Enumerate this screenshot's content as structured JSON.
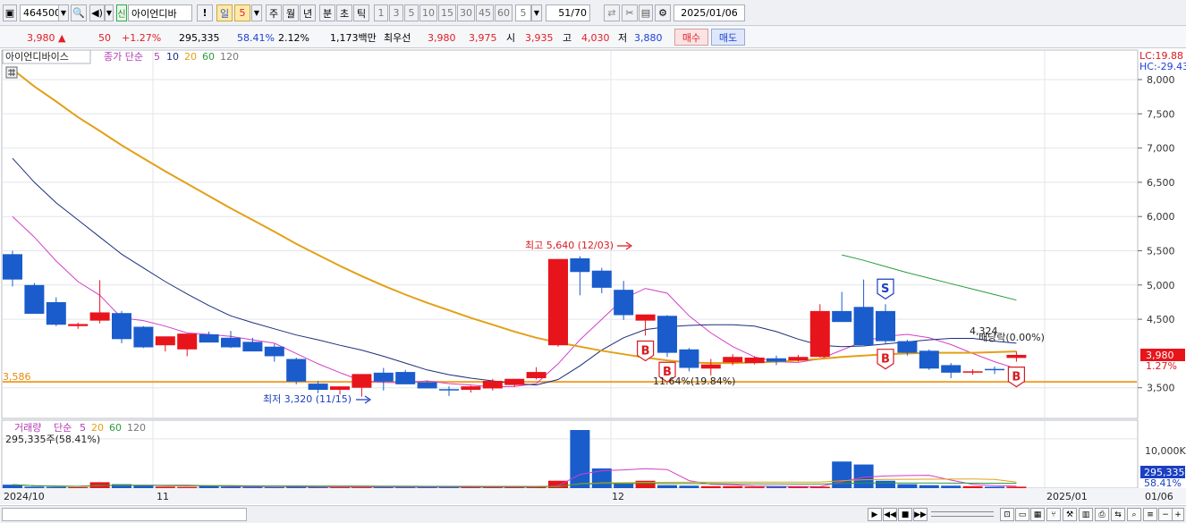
{
  "toolbar": {
    "code": "464500",
    "shin_badge": "신",
    "stock_name": "아이언디바",
    "exclaim": "!",
    "period_day": "일",
    "period_num": "5",
    "tabs": [
      "주",
      "월",
      "년",
      "분",
      "초",
      "틱"
    ],
    "intervals": [
      "1",
      "3",
      "5",
      "10",
      "15",
      "30",
      "45",
      "60"
    ],
    "count": "5",
    "page": "51/70",
    "date": "2025/01/06"
  },
  "quote": {
    "price": "3,980",
    "arrow": "▲",
    "change": "50",
    "change_pct": "+1.27%",
    "volume": "295,335",
    "volume_ratio": "58.41%",
    "turnover_pct": "2.12%",
    "amount": "1,173백만",
    "best_label": "최우선",
    "best_ask": "3,980",
    "best_bid": "3,975",
    "open_label": "시",
    "open": "3,935",
    "high_label": "고",
    "high": "4,030",
    "low_label": "저",
    "low": "3,880",
    "buy_label": "매수",
    "sell_label": "매도"
  },
  "price_legend": {
    "name": "아이언디바이스",
    "ma_label": "종가 단순",
    "periods": [
      "5",
      "10",
      "20",
      "60",
      "120"
    ]
  },
  "volume_legend": {
    "name": "거래량",
    "ma_label": "단순",
    "periods": [
      "5",
      "20",
      "60",
      "120"
    ],
    "info": "295,335주(58.41%)"
  },
  "right_axis": {
    "lc": "LC:19.88",
    "hc": "HC:-29.43",
    "ticks": [
      "8,000",
      "7,500",
      "7,000",
      "6,500",
      "6,000",
      "5,500",
      "5,000",
      "4,500",
      "3,500"
    ],
    "price_tag": "3,980",
    "pct_tag": "1.27%",
    "vol_tick": "10,000K",
    "vol_tag": "295,335",
    "vol_pct_tag": "58.41%"
  },
  "annotations": {
    "hline_label": "3,586",
    "high_note": "최고 5,640 (12/03)",
    "low_note": "최저 3,320 (11/15)",
    "mid_note": "11.64%(19.84%)",
    "ma_note": "4,324",
    "ma_note2": "배당락(0.00%)",
    "buy_marker": "B",
    "sell_marker": "S"
  },
  "x_axis": {
    "labels": [
      "2024/10",
      "11",
      "12",
      "2025/01",
      "01/06"
    ]
  },
  "colors": {
    "up": "#e8141b",
    "down": "#1a5ccc",
    "ma5": "#d23fc8",
    "ma10": "#1a2f7a",
    "ma20": "#e3a017",
    "ma60": "#2b9a3c",
    "hline": "#f0a030"
  },
  "chart_data": {
    "type": "candlestick",
    "ylim": [
      3200,
      8200
    ],
    "volume_ylim": [
      0,
      13000000
    ],
    "x": [
      "10/29",
      "10/30",
      "10/31",
      "11/01",
      "11/04",
      "11/05",
      "11/06",
      "11/07",
      "11/08",
      "11/11",
      "11/12",
      "11/13",
      "11/14",
      "11/15",
      "11/18",
      "11/19",
      "11/20",
      "11/21",
      "11/22",
      "11/25",
      "11/26",
      "11/27",
      "11/28",
      "11/29",
      "12/02",
      "12/03",
      "12/04",
      "12/05",
      "12/06",
      "12/09",
      "12/10",
      "12/11",
      "12/12",
      "12/13",
      "12/16",
      "12/17",
      "12/18",
      "12/19",
      "12/20",
      "12/23",
      "12/24",
      "12/26",
      "12/27",
      "12/30",
      "01/02",
      "01/03",
      "01/06"
    ],
    "open": [
      5450,
      5000,
      4750,
      4400,
      4480,
      4590,
      4390,
      4120,
      4060,
      4280,
      4230,
      4170,
      4100,
      3920,
      3560,
      3470,
      3500,
      3720,
      3730,
      3580,
      3480,
      3470,
      3490,
      3540,
      3640,
      4120,
      5390,
      5210,
      4930,
      4480,
      4550,
      4060,
      3780,
      3870,
      3860,
      3930,
      3900,
      3950,
      4620,
      4680,
      4620,
      4180,
      4040,
      3830,
      3720,
      3775,
      3935
    ],
    "high": [
      5500,
      5030,
      4820,
      4450,
      5070,
      4620,
      4400,
      4220,
      4130,
      4320,
      4330,
      4230,
      4140,
      3940,
      3600,
      3510,
      3570,
      3790,
      3760,
      3600,
      3520,
      3530,
      3630,
      3630,
      3800,
      4650,
      5420,
      5250,
      5060,
      4500,
      4560,
      4080,
      3920,
      3990,
      3960,
      3970,
      3980,
      4720,
      4900,
      5080,
      4720,
      4200,
      4060,
      3860,
      3770,
      3810,
      4030
    ],
    "low": [
      4980,
      4680,
      4400,
      4360,
      4440,
      4150,
      4080,
      4030,
      3960,
      4200,
      4080,
      4050,
      3880,
      3550,
      3420,
      3400,
      3370,
      3460,
      3690,
      3540,
      3380,
      3430,
      3460,
      3510,
      3620,
      4100,
      4850,
      4880,
      4490,
      4260,
      3950,
      3740,
      3680,
      3830,
      3840,
      3830,
      3880,
      3940,
      4620,
      4560,
      4140,
      3970,
      3760,
      3640,
      3690,
      3700,
      3880
    ],
    "close": [
      5080,
      4580,
      4420,
      4430,
      4600,
      4210,
      4090,
      4250,
      4290,
      4160,
      4090,
      4030,
      3960,
      3590,
      3470,
      3520,
      3700,
      3590,
      3550,
      3490,
      3460,
      3520,
      3600,
      3630,
      3730,
      5380,
      5190,
      4960,
      4560,
      4570,
      4010,
      3790,
      3840,
      3950,
      3940,
      3880,
      3950,
      4620,
      4460,
      4120,
      4180,
      4010,
      3780,
      3720,
      3740,
      3760,
      3980
    ],
    "volume": [
      700000,
      300000,
      250000,
      200000,
      1200000,
      800000,
      500000,
      300000,
      250000,
      500000,
      300000,
      250000,
      200000,
      300000,
      200000,
      200000,
      250000,
      300000,
      200000,
      200000,
      250000,
      250000,
      200000,
      200000,
      200000,
      1500000,
      11800000,
      4000000,
      1000000,
      1500000,
      600000,
      500000,
      400000,
      400000,
      300000,
      300000,
      300000,
      300000,
      5400000,
      4800000,
      1500000,
      800000,
      600000,
      500000,
      400000,
      300000,
      295335
    ],
    "ma": {
      "5": [
        6000,
        5700,
        5350,
        5050,
        4850,
        4520,
        4480,
        4400,
        4300,
        4280,
        4250,
        4200,
        4150,
        4000,
        3850,
        3720,
        3600,
        3580,
        3570,
        3600,
        3560,
        3540,
        3510,
        3520,
        3560,
        3850,
        4200,
        4500,
        4800,
        4950,
        4880,
        4550,
        4300,
        4100,
        3950,
        3880,
        3870,
        3920,
        4050,
        4180,
        4250,
        4280,
        4230,
        4130,
        4000,
        3880,
        3780
      ],
      "10": [
        6850,
        6500,
        6200,
        5950,
        5700,
        5450,
        5250,
        5050,
        4870,
        4700,
        4550,
        4450,
        4360,
        4270,
        4200,
        4120,
        4050,
        3960,
        3860,
        3760,
        3690,
        3640,
        3600,
        3560,
        3540,
        3620,
        3820,
        4050,
        4230,
        4350,
        4390,
        4410,
        4420,
        4420,
        4400,
        4320,
        4210,
        4120,
        4100,
        4110,
        4140,
        4170,
        4200,
        4220,
        4220,
        4180,
        4150
      ],
      "20": [
        8150,
        7900,
        7680,
        7450,
        7250,
        7040,
        6850,
        6660,
        6480,
        6300,
        6120,
        5950,
        5780,
        5600,
        5440,
        5280,
        5130,
        4990,
        4860,
        4740,
        4630,
        4520,
        4420,
        4320,
        4230,
        4160,
        4100,
        4040,
        3990,
        3940,
        3900,
        3870,
        3860,
        3860,
        3870,
        3880,
        3900,
        3920,
        3950,
        3970,
        3990,
        4000,
        4010,
        4010,
        4010,
        4020,
        4030
      ],
      "60": [
        null,
        null,
        null,
        null,
        null,
        null,
        null,
        null,
        null,
        null,
        null,
        null,
        null,
        null,
        null,
        null,
        null,
        null,
        null,
        null,
        null,
        null,
        null,
        null,
        null,
        null,
        null,
        null,
        null,
        null,
        null,
        null,
        null,
        null,
        null,
        null,
        null,
        null,
        5440,
        5360,
        5270,
        5180,
        5100,
        5020,
        4940,
        4860,
        4780
      ]
    }
  }
}
